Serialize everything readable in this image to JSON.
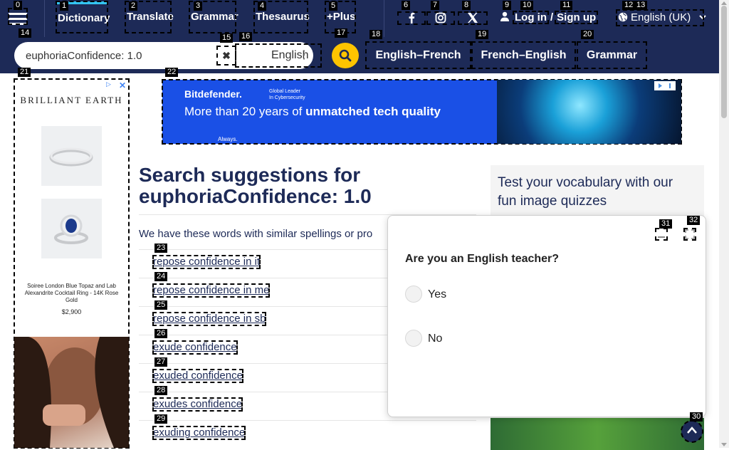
{
  "nav": {
    "links": [
      {
        "label": "Dictionary",
        "mark": "1"
      },
      {
        "label": "Translate",
        "mark": "2"
      },
      {
        "label": "Grammar",
        "mark": "3"
      },
      {
        "label": "Thesaurus",
        "mark": "4"
      },
      {
        "label": "+Plus",
        "mark": "5"
      }
    ],
    "login": "Log in",
    "slash": "/",
    "signup": "Sign up",
    "language": "English (UK)"
  },
  "search": {
    "value": "euphoriaConfidence: 1.0",
    "dictionary": "English",
    "tabs": [
      "English–French",
      "French–English",
      "Grammar"
    ]
  },
  "ads": {
    "left": {
      "brand": "BRILLIANT EARTH",
      "product_name": "Soiree London Blue Topaz and Lab Alexandrite Cocktail Ring - 14K Rose Gold",
      "price": "$2,900"
    },
    "banner": {
      "brand": "Bitdefender.",
      "subline_1": "Global Leader",
      "subline_2": "In Cybersecurity",
      "tagline_plain": "More than 20 years of ",
      "tagline_bold": "unmatched tech quality",
      "footer": "Always."
    }
  },
  "results": {
    "heading": "Search suggestions for",
    "term": "euphoriaConfidence: 1.0",
    "intro": "We have these words with similar spellings or pro",
    "suggestions": [
      "repose confidence in it",
      "repose confidence in me",
      "repose confidence in sb",
      "exude confidence",
      "exuded confidence",
      "exudes confidence",
      "exuding confidence"
    ]
  },
  "sidebar": {
    "quiz_title": "Test your vocabulary with our fun image quizzes"
  },
  "survey": {
    "question": "Are you an English teacher?",
    "options": [
      "Yes",
      "No"
    ]
  },
  "marks": [
    "0",
    "6",
    "7",
    "8",
    "9",
    "10",
    "11",
    "12",
    "13",
    "14",
    "15",
    "16",
    "17",
    "18",
    "19",
    "20",
    "21",
    "22",
    "23",
    "24",
    "25",
    "26",
    "27",
    "28",
    "29",
    "30",
    "31",
    "32"
  ],
  "colors": {
    "navy": "#1d2a57",
    "search_yellow": "#fec400",
    "active_tab": "#33c3f0",
    "banner_blue": "#1a50e6"
  }
}
